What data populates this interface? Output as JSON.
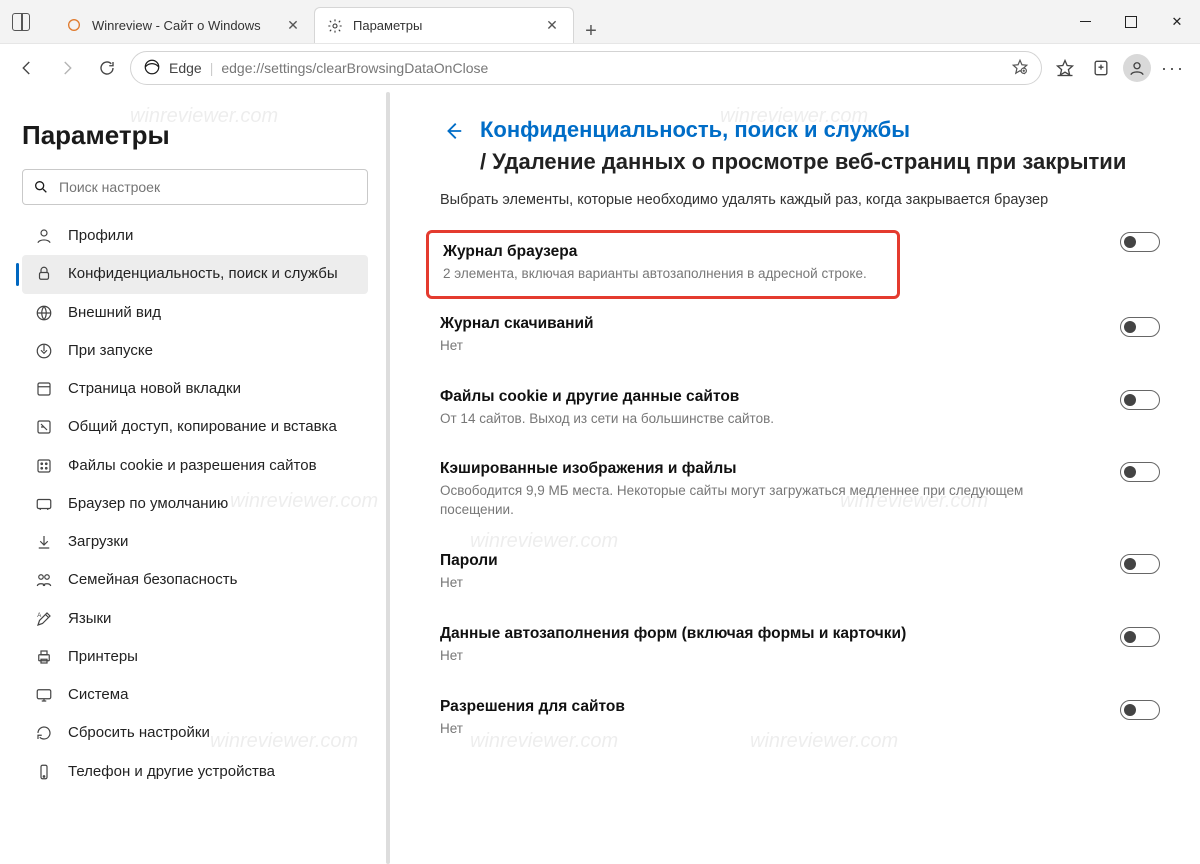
{
  "window": {
    "tabs": [
      {
        "title": "Winreview - Сайт о Windows",
        "active": false
      },
      {
        "title": "Параметры",
        "active": true
      }
    ]
  },
  "addressbar": {
    "edge_label": "Edge",
    "url": "edge://settings/clearBrowsingDataOnClose"
  },
  "sidebar": {
    "title": "Параметры",
    "search_placeholder": "Поиск настроек",
    "items": [
      {
        "label": "Профили"
      },
      {
        "label": "Конфиденциальность, поиск и службы"
      },
      {
        "label": "Внешний вид"
      },
      {
        "label": "При запуске"
      },
      {
        "label": "Страница новой вкладки"
      },
      {
        "label": "Общий доступ, копирование и вставка"
      },
      {
        "label": "Файлы cookie и разрешения сайтов"
      },
      {
        "label": "Браузер по умолчанию"
      },
      {
        "label": "Загрузки"
      },
      {
        "label": "Семейная безопасность"
      },
      {
        "label": "Языки"
      },
      {
        "label": "Принтеры"
      },
      {
        "label": "Система"
      },
      {
        "label": "Сбросить настройки"
      },
      {
        "label": "Телефон и другие устройства"
      }
    ],
    "active_index": 1
  },
  "panel": {
    "breadcrumb_parent": "Конфиденциальность, поиск и службы",
    "breadcrumb_sep": "/ ",
    "breadcrumb_current": "Удаление данных о просмотре веб-страниц при закрытии",
    "description": "Выбрать элементы, которые необходимо удалять каждый раз, когда закрывается браузер",
    "settings": [
      {
        "title": "Журнал браузера",
        "desc": "2 элемента, включая варианты автозаполнения в адресной строке.",
        "on": false,
        "highlight": true
      },
      {
        "title": "Журнал скачиваний",
        "desc": "Нет",
        "on": false
      },
      {
        "title": "Файлы cookie и другие данные сайтов",
        "desc": "От 14 сайтов. Выход из сети на большинстве сайтов.",
        "on": false
      },
      {
        "title": "Кэшированные изображения и файлы",
        "desc": "Освободится 9,9 МБ места. Некоторые сайты могут загружаться медленнее при следующем посещении.",
        "on": false
      },
      {
        "title": "Пароли",
        "desc": "Нет",
        "on": false
      },
      {
        "title": "Данные автозаполнения форм (включая формы и карточки)",
        "desc": "Нет",
        "on": false
      },
      {
        "title": "Разрешения для сайтов",
        "desc": "Нет",
        "on": false
      }
    ]
  },
  "watermark": "winreviewer.com"
}
